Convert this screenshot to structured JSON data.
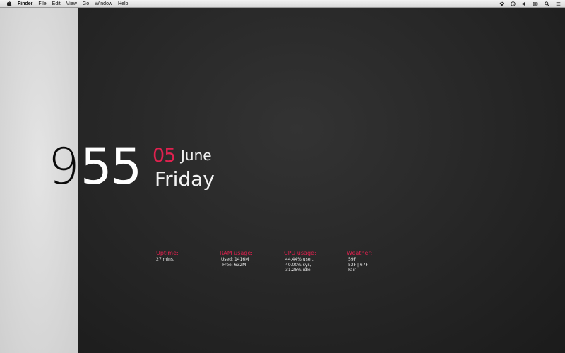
{
  "menubar": {
    "app_name": "Finder",
    "items": [
      "File",
      "Edit",
      "View",
      "Go",
      "Window",
      "Help"
    ],
    "tray_icons": [
      "paw-icon",
      "time-machine-icon",
      "volume-icon",
      "battery-icon",
      "search-icon",
      "list-icon"
    ]
  },
  "clock": {
    "hour": "9",
    "minutes": "55",
    "day": "05",
    "month": "June",
    "weekday": "Friday"
  },
  "stats": {
    "uptime": {
      "title": "Uptime:",
      "lines": [
        "27 mins,"
      ]
    },
    "ram": {
      "title": "RAM usage:",
      "lines": [
        "Used: 1416M",
        "Free: 632M"
      ]
    },
    "cpu": {
      "title": "CPU usage:",
      "lines": [
        "44.44% user,",
        "40.00% sys,",
        "31.25% idle"
      ]
    },
    "weather": {
      "title": "Weather:",
      "lines": [
        "59F",
        "52F | 67F",
        "Fair"
      ]
    }
  },
  "colors": {
    "accent": "#e0214f",
    "dark_background": "#262626",
    "light_panel": "#d9d9d9"
  }
}
